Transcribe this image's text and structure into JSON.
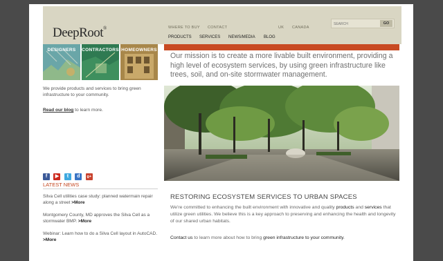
{
  "header": {
    "logo_text": "DeepRoot",
    "logo_mark": "®",
    "top_links": [
      "WHERE TO BUY",
      "CONTACT",
      "UK",
      "CANADA"
    ],
    "nav": [
      "PRODUCTS",
      "SERVICES",
      "NEWS/MEDIA",
      "BLOG"
    ],
    "search": {
      "placeholder": "SEARCH",
      "button": "GO"
    }
  },
  "tiles": [
    {
      "label": "DESIGNERS",
      "color": "#5a9aa0"
    },
    {
      "label": "CONTRACTORS",
      "color": "#2f7a52"
    },
    {
      "label": "HOMEOWNERS",
      "color": "#b89a54"
    }
  ],
  "left": {
    "intro": "We provide products and services to bring green infrastructure to your community.",
    "blog_link": "Read our blog",
    "blog_suffix": " to learn more."
  },
  "social": [
    {
      "name": "facebook",
      "glyph": "f",
      "color": "#3b5998"
    },
    {
      "name": "youtube",
      "glyph": "▶",
      "color": "#cc2a1e"
    },
    {
      "name": "twitter",
      "glyph": "t",
      "color": "#3fa9e0"
    },
    {
      "name": "delicious",
      "glyph": "d",
      "color": "#3a74c4"
    },
    {
      "name": "googleplus",
      "glyph": "g+",
      "color": "#c9432f"
    }
  ],
  "news": {
    "title": "LATEST NEWS",
    "items": [
      {
        "text": "Silva Cell utilities case study: planned watermain repair along a street ",
        "more": ">More"
      },
      {
        "text": "Montgomery County, MD approves the Silva Cell as a stormwater BMP. ",
        "more": ">More"
      },
      {
        "text": "Webinar: Learn how to do a Silva Cell layout in AutoCAD. ",
        "more": ">More"
      }
    ]
  },
  "main": {
    "mission": "Our mission is to create a more livable built environment, providing a high level of ecosystem services, by using green infrastructure like trees, soil, and on-site stormwater management.",
    "section_title": "RESTORING ECOSYSTEM SERVICES TO URBAN SPACES",
    "body_p1_a": "We're committed to enhancing the built environment with innovative and quality ",
    "body_p1_link1": "products",
    "body_p1_b": " and ",
    "body_p1_link2": "services",
    "body_p1_c": " that utilize green utilities. We believe this is a key approach to preserving and enhancing the health and longevity of our shared urban habitats.",
    "body_p2_link": "Contact us",
    "body_p2_a": " to learn more about how to bring ",
    "body_p2_dark": "green infrastructure to your community",
    "body_p2_b": "."
  }
}
